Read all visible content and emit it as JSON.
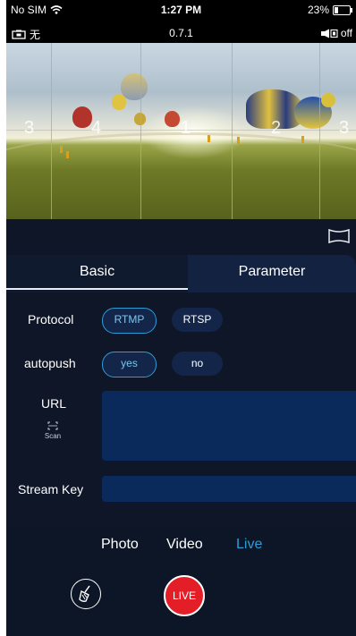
{
  "status_bar": {
    "carrier": "No SIM",
    "time": "1:27 PM",
    "battery": "23%",
    "battery_level": 0.23,
    "icons": [
      "wifi-icon",
      "battery-icon"
    ]
  },
  "camera_bar": {
    "storage_label": "无",
    "version": "0.7.1",
    "speaker_state": "off",
    "icons": [
      "camera-storage-icon",
      "speaker-icon"
    ]
  },
  "preview": {
    "sector_numbers": [
      "3",
      "4",
      "1",
      "2",
      "3"
    ]
  },
  "view_mode": {
    "icon": "panorama-view-icon"
  },
  "tabs": {
    "basic": "Basic",
    "parameter": "Parameter",
    "active": "Basic"
  },
  "settings": {
    "protocol": {
      "label": "Protocol",
      "options": [
        "RTMP",
        "RTSP"
      ],
      "selected": "RTMP"
    },
    "autopush": {
      "label": "autopush",
      "options": [
        "yes",
        "no"
      ],
      "selected": "yes"
    },
    "url": {
      "label": "URL",
      "value": "",
      "scan_label": "Scan"
    },
    "stream_key": {
      "label": "Stream Key",
      "value": ""
    }
  },
  "modes": {
    "items": [
      "Photo",
      "Video",
      "Live"
    ],
    "selected": "Live",
    "accent_color": "#2d9cd6"
  },
  "actions": {
    "live_label": "LIVE",
    "live_color": "#e41e26",
    "clean_icon": "broom-icon"
  }
}
